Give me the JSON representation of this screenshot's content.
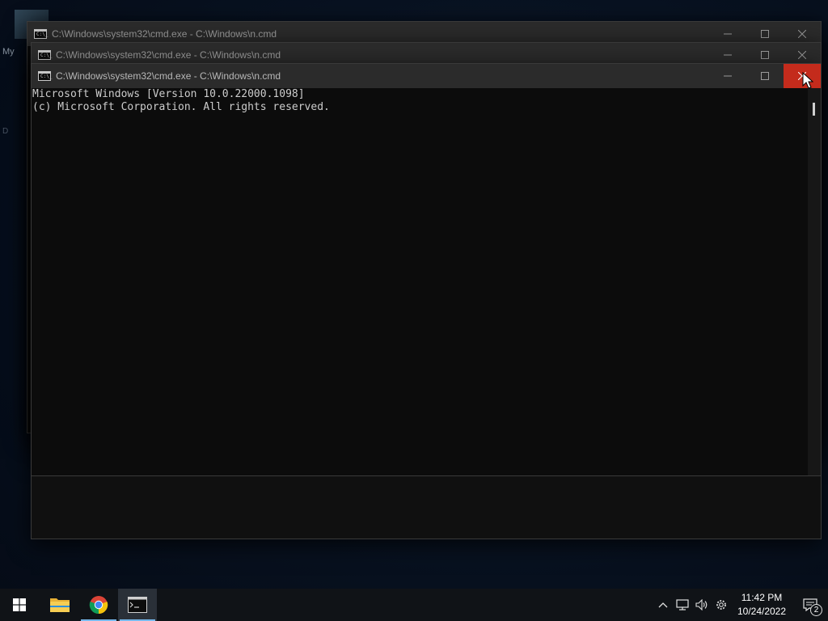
{
  "desktop": {
    "label_1": "My",
    "label_2": "D"
  },
  "windows": [
    {
      "title": "C:\\Windows\\system32\\cmd.exe - C:\\Windows\\n.cmd"
    },
    {
      "title": "C:\\Windows\\system32\\cmd.exe - C:\\Windows\\n.cmd"
    },
    {
      "title": "C:\\Windows\\system32\\cmd.exe - C:\\Windows\\n.cmd"
    }
  ],
  "console": {
    "line_1": "Microsoft Windows [Version 10.0.22000.1098]",
    "line_2": "(c) Microsoft Corporation. All rights reserved."
  },
  "icon_glyphs": {
    "cmd": "C:\\_"
  },
  "icons": {
    "title_app": "cmd-icon",
    "minimize": "minimize-icon",
    "maximize": "maximize-icon",
    "close": "close-icon",
    "start": "windows-start-icon",
    "explorer": "folder-icon",
    "chrome": "chrome-icon",
    "terminal": "cmd-icon",
    "tray": [
      "chevron-up-icon",
      "network-icon",
      "volume-icon",
      "settings-icon"
    ],
    "notifications": "notification-icon"
  },
  "taskbar": {
    "clock_time": "11:42 PM",
    "clock_date": "10/24/2022",
    "notification_count": "2"
  },
  "colors": {
    "close_hover": "#c42b1c",
    "taskbar_indicator": "#76b9ed",
    "console_text": "#cccccc"
  }
}
